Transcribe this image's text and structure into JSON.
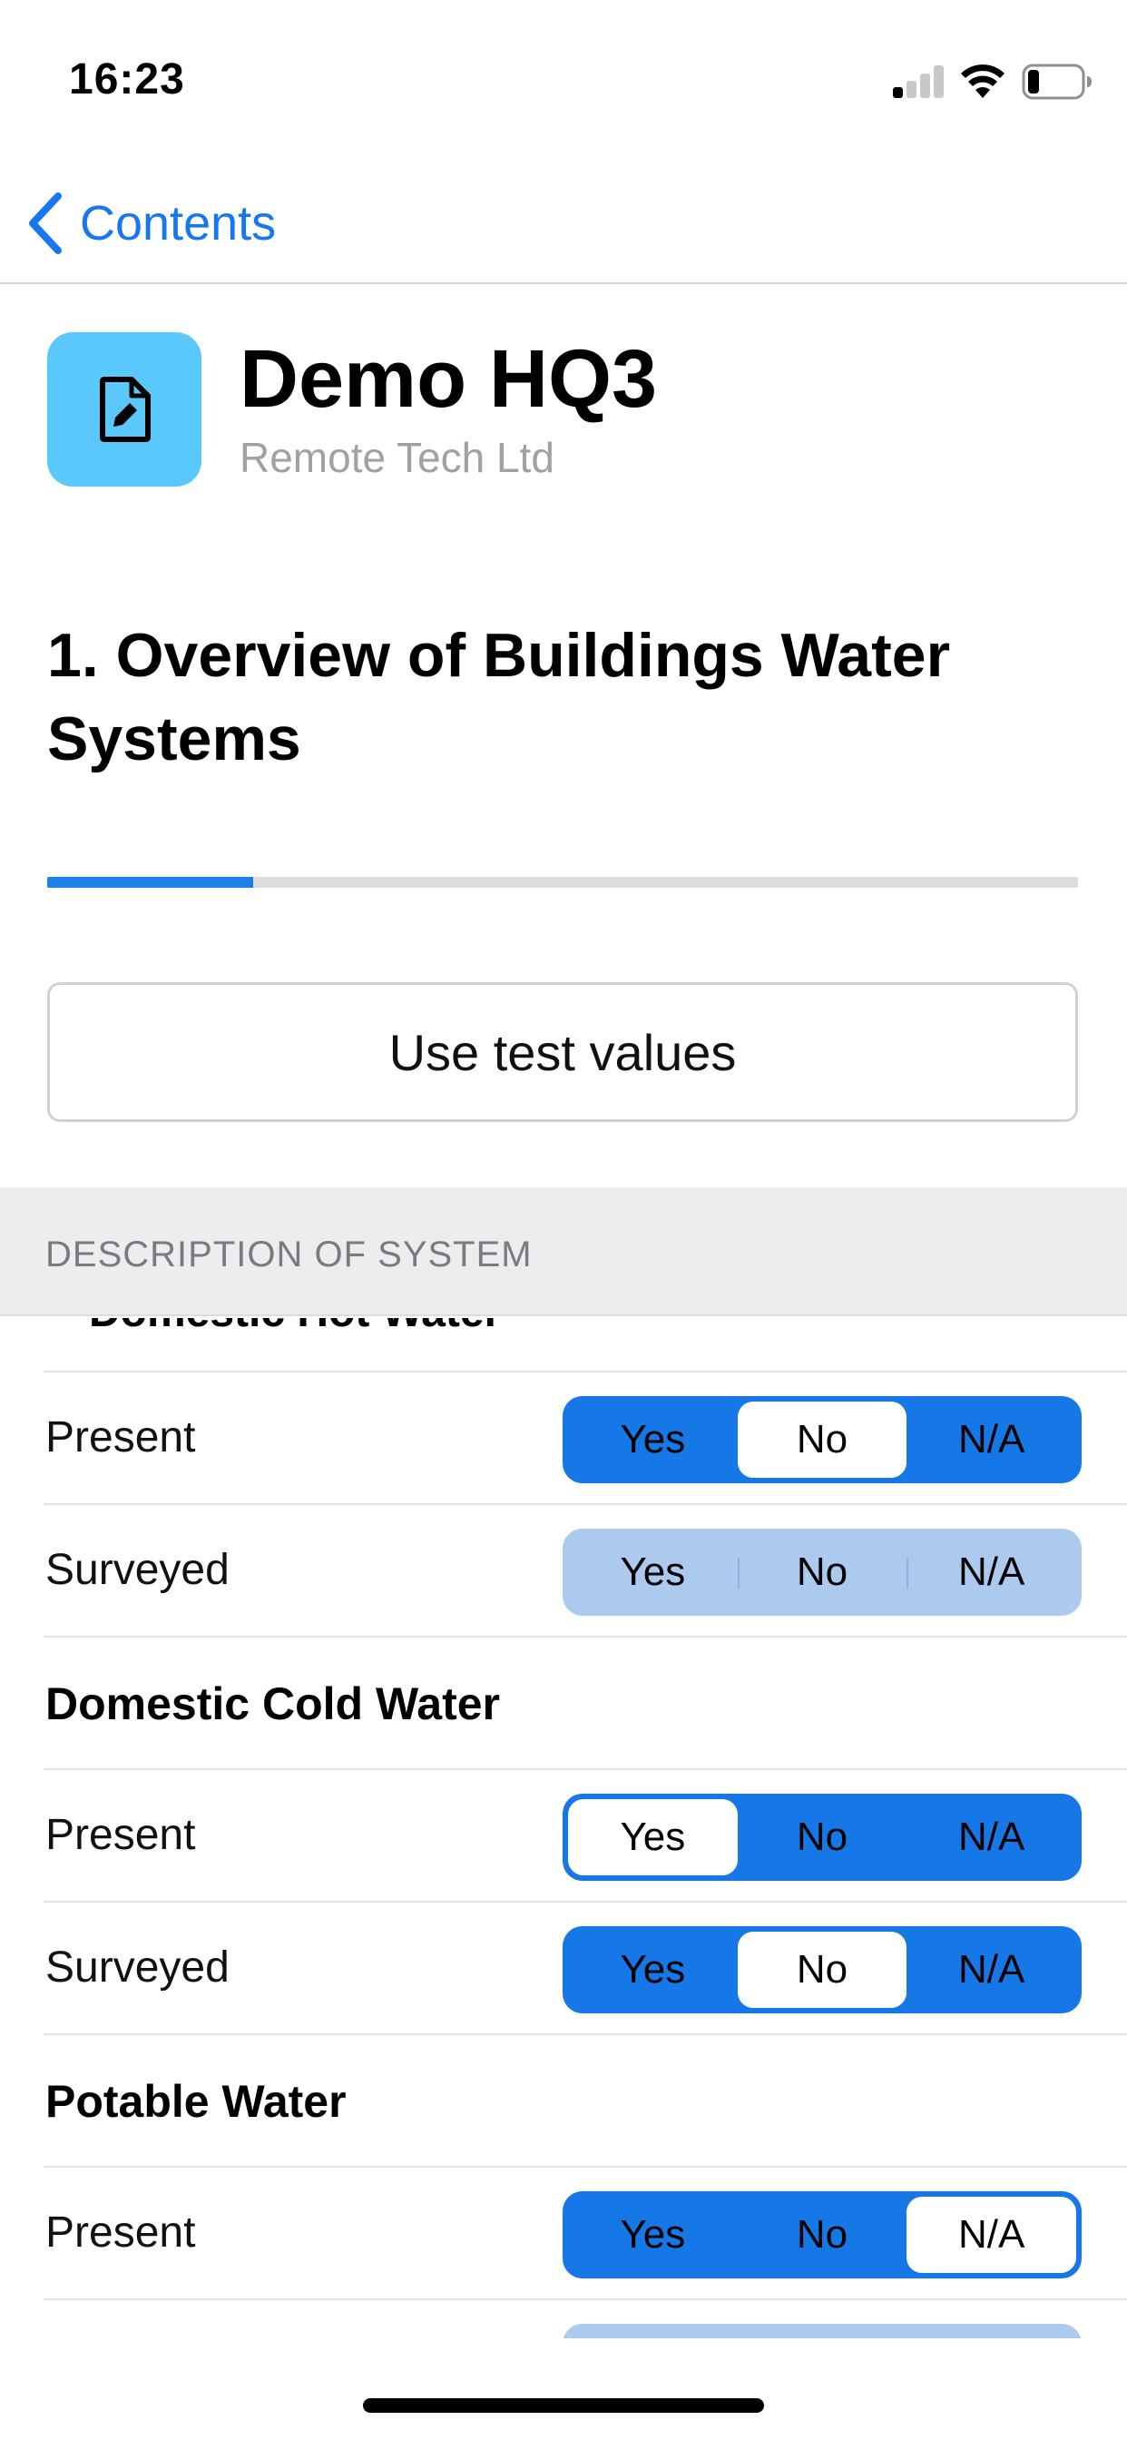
{
  "status_bar": {
    "time": "16:23",
    "signal_bars_active": 1,
    "signal_bars_total": 4,
    "battery_level": 0.2
  },
  "nav": {
    "back_label": "Contents"
  },
  "header": {
    "icon": "document-edit-icon",
    "title": "Demo HQ3",
    "subtitle": "Remote Tech Ltd"
  },
  "section": {
    "title": "1. Overview of Buildings Water Systems",
    "progress": 0.2
  },
  "test_button": {
    "label": "Use test values"
  },
  "section_header": {
    "label": "DESCRIPTION OF SYSTEM"
  },
  "partial_heading": "Domestic Hot Water",
  "options": [
    "Yes",
    "No",
    "N/A"
  ],
  "rows": [
    {
      "label": "Present",
      "selected": "No",
      "enabled": true
    },
    {
      "label": "Surveyed",
      "selected": null,
      "enabled": false
    },
    {
      "heading": "Domestic Cold Water"
    },
    {
      "label": "Present",
      "selected": "Yes",
      "enabled": true
    },
    {
      "label": "Surveyed",
      "selected": "No",
      "enabled": true
    },
    {
      "heading": "Potable Water"
    },
    {
      "label": "Present",
      "selected": "N/A",
      "enabled": true
    }
  ],
  "colors": {
    "accent": "#1677e6",
    "disabled_segment": "#abcaee",
    "icon_bg": "#5ac8fa",
    "section_bg": "#ededf0"
  }
}
